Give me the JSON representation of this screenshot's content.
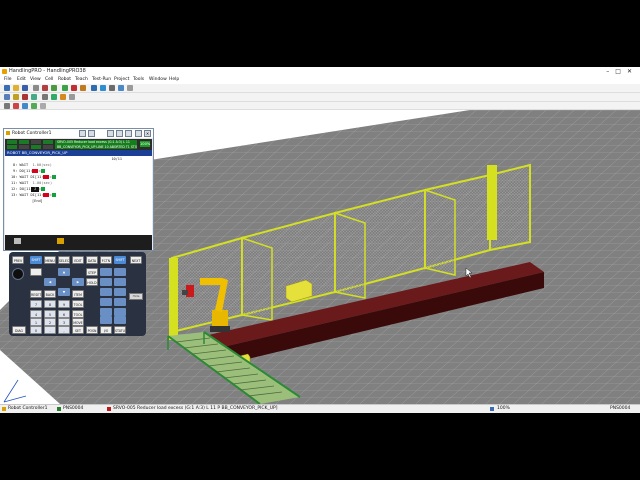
{
  "window": {
    "title": "HandlingPRO - HandlingPRO38",
    "controls": [
      "–",
      "□",
      "✕"
    ]
  },
  "menu": [
    "File",
    "Edit",
    "View",
    "Cell",
    "Robot",
    "Teach",
    "Test-Run",
    "Project",
    "Tools",
    "Window",
    "Help"
  ],
  "tp": {
    "title": "Robot Controller1",
    "alarm_line1": "SRVO-005 Reducer load excess (G:1 A:3) L 11",
    "alarm_line2": "BB_CONVEYOR_PICK_UP LINE 10  ABORTED  T1  STOP",
    "speed": "100%",
    "program_header": "ROBOT  BB_CONVEYOR_PICK_UP",
    "line_info": "10/11",
    "lines": [
      {
        "num": "8:",
        "text": "WAIT",
        "extra": "1.00(sec)"
      },
      {
        "num": "9:",
        "text": "DO[11:",
        "extra": ""
      },
      {
        "num": "10:",
        "text": "WAIT DI[11:",
        "extra": ""
      },
      {
        "num": "11:",
        "text": "WAIT",
        "extra": "1.00(sec)"
      },
      {
        "num": "12:",
        "text": "DO[11:",
        "extra": ""
      },
      {
        "num": "13:",
        "text": "WAIT DI[11:",
        "extra": ""
      },
      {
        "num": "[End]",
        "text": "",
        "extra": ""
      }
    ],
    "cursor_label": "J"
  },
  "keypad": {
    "row1": [
      "PREV",
      "SHIFT",
      "MENU",
      "SELECT",
      "EDIT",
      "DATA",
      "FCTN",
      "SHIFT",
      "NEXT"
    ],
    "row2": [
      "STEP",
      "HOLD"
    ],
    "row3": [
      "RESET",
      "BACK SPACE",
      "ITEM"
    ],
    "row4": [
      "7",
      "8",
      "9",
      "TOOL 1"
    ],
    "row5": [
      "4",
      "5",
      "6",
      "TOOL 2"
    ],
    "row6": [
      "1",
      "2",
      "3",
      "MOVE MENU"
    ],
    "row7": [
      "0",
      ".",
      ",",
      "SET UP"
    ],
    "row8": [
      "DIAG HELP",
      "POSN",
      "I/O",
      "STATUS"
    ],
    "side_button": "Hide"
  },
  "status": {
    "controller": "Robot Controller1",
    "pns": "PNS0004",
    "alarm": "SRVO-005 Reducer load excess (G:1 A:3) L 11 P BB_CONVEYOR_PICK_UP]",
    "zoom": "100%",
    "pns_right": "PNS0004"
  },
  "colors": {
    "tp_header": "#1c3f96",
    "alarm_bg": "#167d1d",
    "fence": "#d4e020",
    "conveyor": "#5a1414",
    "robot": "#f0c000",
    "floor_grid": "#7d7d7d"
  }
}
